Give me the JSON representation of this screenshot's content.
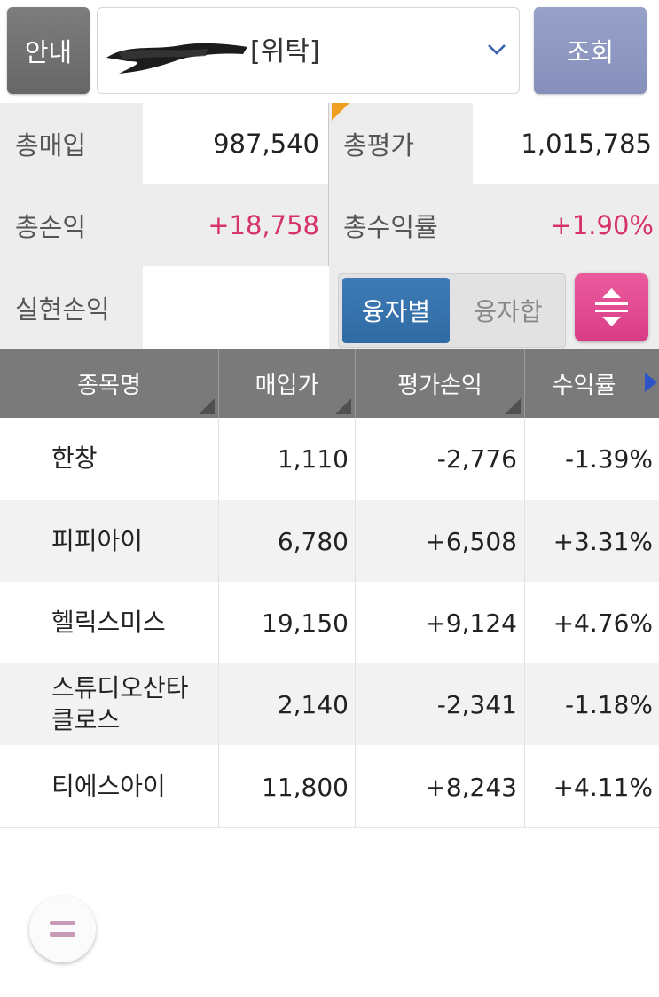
{
  "topbar": {
    "info_label": "안내",
    "account_type": "[위탁]",
    "query_label": "조회"
  },
  "summary": {
    "total_purchase_label": "총매입",
    "total_purchase_value": "987,540",
    "total_eval_label": "총평가",
    "total_eval_value": "1,015,785",
    "total_pl_label": "총손익",
    "total_pl_value": "+18,758",
    "total_return_label": "총수익률",
    "total_return_value": "+1.90%",
    "realized_pl_label": "실현손익",
    "realized_pl_value": "",
    "toggle_a": "융자별",
    "toggle_b": "융자합"
  },
  "table": {
    "headers": [
      "종목명",
      "매입가",
      "평가손익",
      "수익률"
    ],
    "rows": [
      {
        "name": "한창",
        "price": "1,110",
        "pl": "-2,776",
        "ret": "-1.39%"
      },
      {
        "name": "피피아이",
        "price": "6,780",
        "pl": "+6,508",
        "ret": "+3.31%"
      },
      {
        "name": "헬릭스미스",
        "price": "19,150",
        "pl": "+9,124",
        "ret": "+4.76%"
      },
      {
        "name": "스튜디오산타\n클로스",
        "price": "2,140",
        "pl": "-2,341",
        "ret": "-1.18%"
      },
      {
        "name": "티에스아이",
        "price": "11,800",
        "pl": "+8,243",
        "ret": "+4.11%"
      }
    ]
  },
  "colors": {
    "positive": "#d6336c",
    "negative": "#2b55b5",
    "header_bg": "#7a7a7a",
    "query_button": "#8f99c3",
    "toggle_active": "#3672ad",
    "sort_button": "#e24c92"
  },
  "icons": [
    "chevron-down-icon",
    "sort-updown-icon",
    "next-column-arrow-icon",
    "menu-equals-icon"
  ]
}
